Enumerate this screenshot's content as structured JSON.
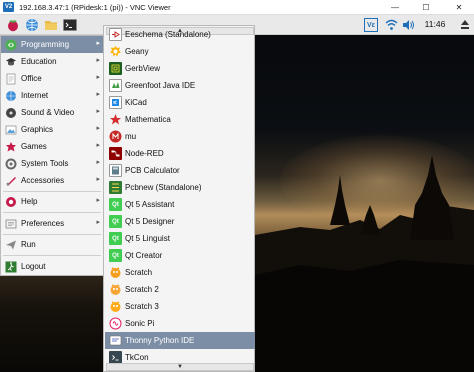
{
  "window": {
    "title": "192.168.3.47:1 (RPidesk:1 (pi)) - VNC Viewer",
    "minimize": "—",
    "maximize": "☐",
    "close": "✕"
  },
  "taskbar": {
    "vc_badge": "Vε",
    "clock": "11:46"
  },
  "main_menu": {
    "items": [
      {
        "label": "Programming",
        "icon": "programming-icon",
        "selected": true
      },
      {
        "label": "Education",
        "icon": "education-icon"
      },
      {
        "label": "Office",
        "icon": "office-icon"
      },
      {
        "label": "Internet",
        "icon": "internet-icon"
      },
      {
        "label": "Sound & Video",
        "icon": "sound-video-icon"
      },
      {
        "label": "Graphics",
        "icon": "graphics-icon"
      },
      {
        "label": "Games",
        "icon": "games-icon"
      },
      {
        "label": "System Tools",
        "icon": "system-tools-icon"
      },
      {
        "label": "Accessories",
        "icon": "accessories-icon"
      },
      {
        "label": "Help",
        "icon": "help-icon"
      },
      {
        "label": "Preferences",
        "icon": "preferences-icon"
      },
      {
        "label": "Run",
        "icon": "run-icon"
      },
      {
        "label": "Logout",
        "icon": "logout-icon"
      }
    ],
    "arrow": "▸"
  },
  "sub_menu": {
    "scroll_up": "▲",
    "scroll_down": "▼",
    "items": [
      {
        "label": "Eeschema (Standalone)",
        "icon": "eeschema-icon"
      },
      {
        "label": "Geany",
        "icon": "geany-icon"
      },
      {
        "label": "GerbView",
        "icon": "gerbview-icon"
      },
      {
        "label": "Greenfoot Java IDE",
        "icon": "greenfoot-icon"
      },
      {
        "label": "KiCad",
        "icon": "kicad-icon"
      },
      {
        "label": "Mathematica",
        "icon": "mathematica-icon"
      },
      {
        "label": "mu",
        "icon": "mu-icon"
      },
      {
        "label": "Node-RED",
        "icon": "node-red-icon"
      },
      {
        "label": "PCB Calculator",
        "icon": "pcb-calculator-icon"
      },
      {
        "label": "Pcbnew (Standalone)",
        "icon": "pcbnew-icon"
      },
      {
        "label": "Qt 5 Assistant",
        "icon": "qt-assistant-icon"
      },
      {
        "label": "Qt 5 Designer",
        "icon": "qt-designer-icon"
      },
      {
        "label": "Qt 5 Linguist",
        "icon": "qt-linguist-icon"
      },
      {
        "label": "Qt Creator",
        "icon": "qt-creator-icon"
      },
      {
        "label": "Scratch",
        "icon": "scratch-icon"
      },
      {
        "label": "Scratch 2",
        "icon": "scratch2-icon"
      },
      {
        "label": "Scratch 3",
        "icon": "scratch3-icon"
      },
      {
        "label": "Sonic Pi",
        "icon": "sonic-pi-icon"
      },
      {
        "label": "Thonny Python IDE",
        "icon": "thonny-icon",
        "selected": true
      },
      {
        "label": "TkCon",
        "icon": "tkcon-icon"
      }
    ]
  },
  "colors": {
    "selection": "#7c8ea5",
    "menu_bg": "#f4f4f4",
    "raspberry": "#c51a4a",
    "qt_green": "#41cd52"
  }
}
